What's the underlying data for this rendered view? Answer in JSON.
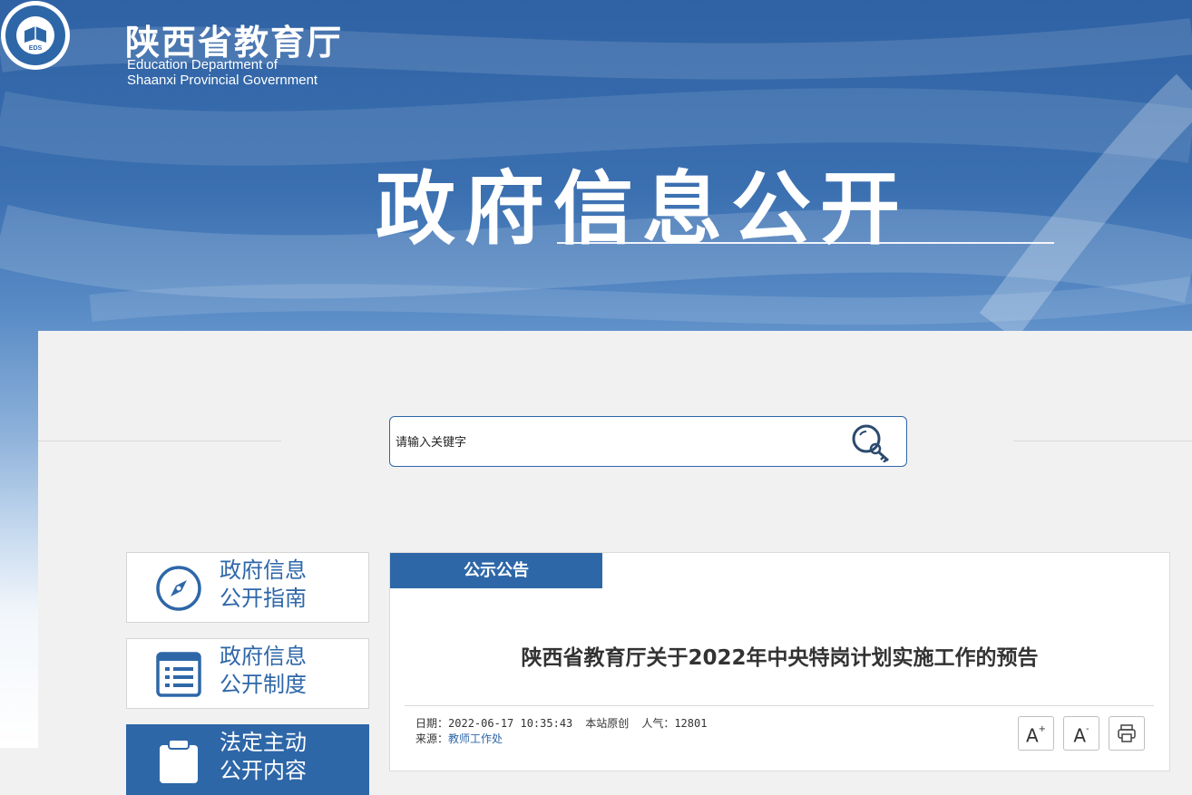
{
  "header": {
    "org_name_cn": "陕西省教育厅",
    "org_name_en_line1": "Education Department of",
    "org_name_en_line2": "Shaanxi Provincial Government",
    "logo_text": "EDS",
    "hero_title": "政府信息公开"
  },
  "search": {
    "placeholder": "请输入关键字",
    "button_icon": "search-key-icon"
  },
  "sidebar": {
    "items": [
      {
        "line1": "政府信息",
        "line2": "公开指南",
        "icon": "compass-icon"
      },
      {
        "line1": "政府信息",
        "line2": "公开制度",
        "icon": "list-document-icon"
      },
      {
        "line1": "法定主动",
        "line2": "公开内容",
        "icon": "clipboard-icon"
      }
    ]
  },
  "content": {
    "tab_label": "公示公告",
    "title": "陕西省教育厅关于2022年中央特岗计划实施工作的预告",
    "meta": {
      "date_label": "日期：",
      "date_value": "2022-06-17 10:35:43",
      "origin": "本站原创",
      "views_label": "人气：",
      "views_value": "12801",
      "source_label": "来源：",
      "source_value": "教师工作处"
    },
    "tools": {
      "increase_font": "A",
      "increase_sup": "+",
      "decrease_font": "A",
      "decrease_sup": "-",
      "print_icon": "printer-icon"
    }
  },
  "colors": {
    "brand_blue": "#2e67a8",
    "panel_bg": "#f1f1f1",
    "text_dark": "#333333"
  }
}
